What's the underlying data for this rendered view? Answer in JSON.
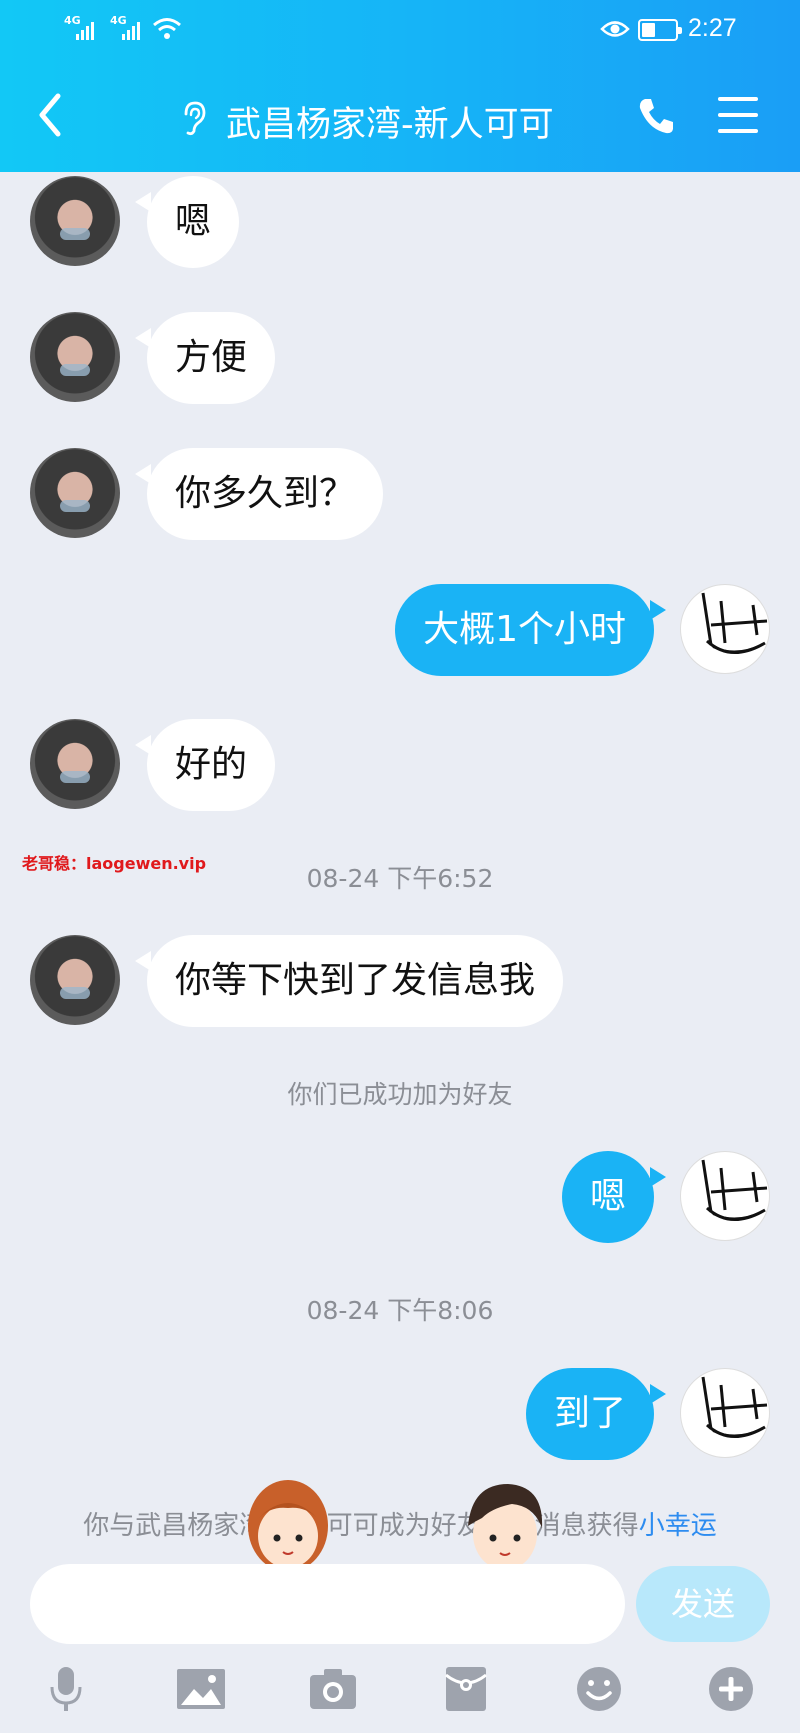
{
  "status_bar": {
    "network_1": "4G",
    "network_2": "4G",
    "time": "2:27",
    "battery_level": 0.4
  },
  "header": {
    "title": "武昌杨家湾-新人可可"
  },
  "messages": [
    {
      "side": "in",
      "text": "嗯"
    },
    {
      "side": "in",
      "text": "方便"
    },
    {
      "side": "in",
      "text": "你多久到？"
    },
    {
      "side": "out",
      "text": "大概1个小时"
    },
    {
      "side": "in",
      "text": "好的"
    },
    {
      "side": "in",
      "text": "你等下快到了发信息我"
    },
    {
      "side": "out",
      "text": "嗯"
    },
    {
      "side": "out",
      "text": "到了"
    }
  ],
  "timestamps": [
    "08-24 下午6:52",
    "08-24 下午8:06"
  ],
  "system_notice": "你们已成功加为好友",
  "watermark": "老哥稳：laogewen.vip",
  "bottom_notice": {
    "text": "你与武昌杨家湾-新人可可成为好友，发消息获得",
    "link": "小幸运"
  },
  "composer": {
    "placeholder": "",
    "send_label": "发送"
  },
  "toolbar_icons": [
    "microphone-icon",
    "image-icon",
    "camera-icon",
    "red-packet-icon",
    "emoji-icon",
    "plus-icon"
  ],
  "colors": {
    "header_start": "#12c8f6",
    "header_end": "#1a9ef6",
    "outgoing_bubble": "#1ab3f5",
    "send_disabled": "#b8e8fb",
    "link": "#2d8cf0",
    "background": "#eaedf4"
  }
}
